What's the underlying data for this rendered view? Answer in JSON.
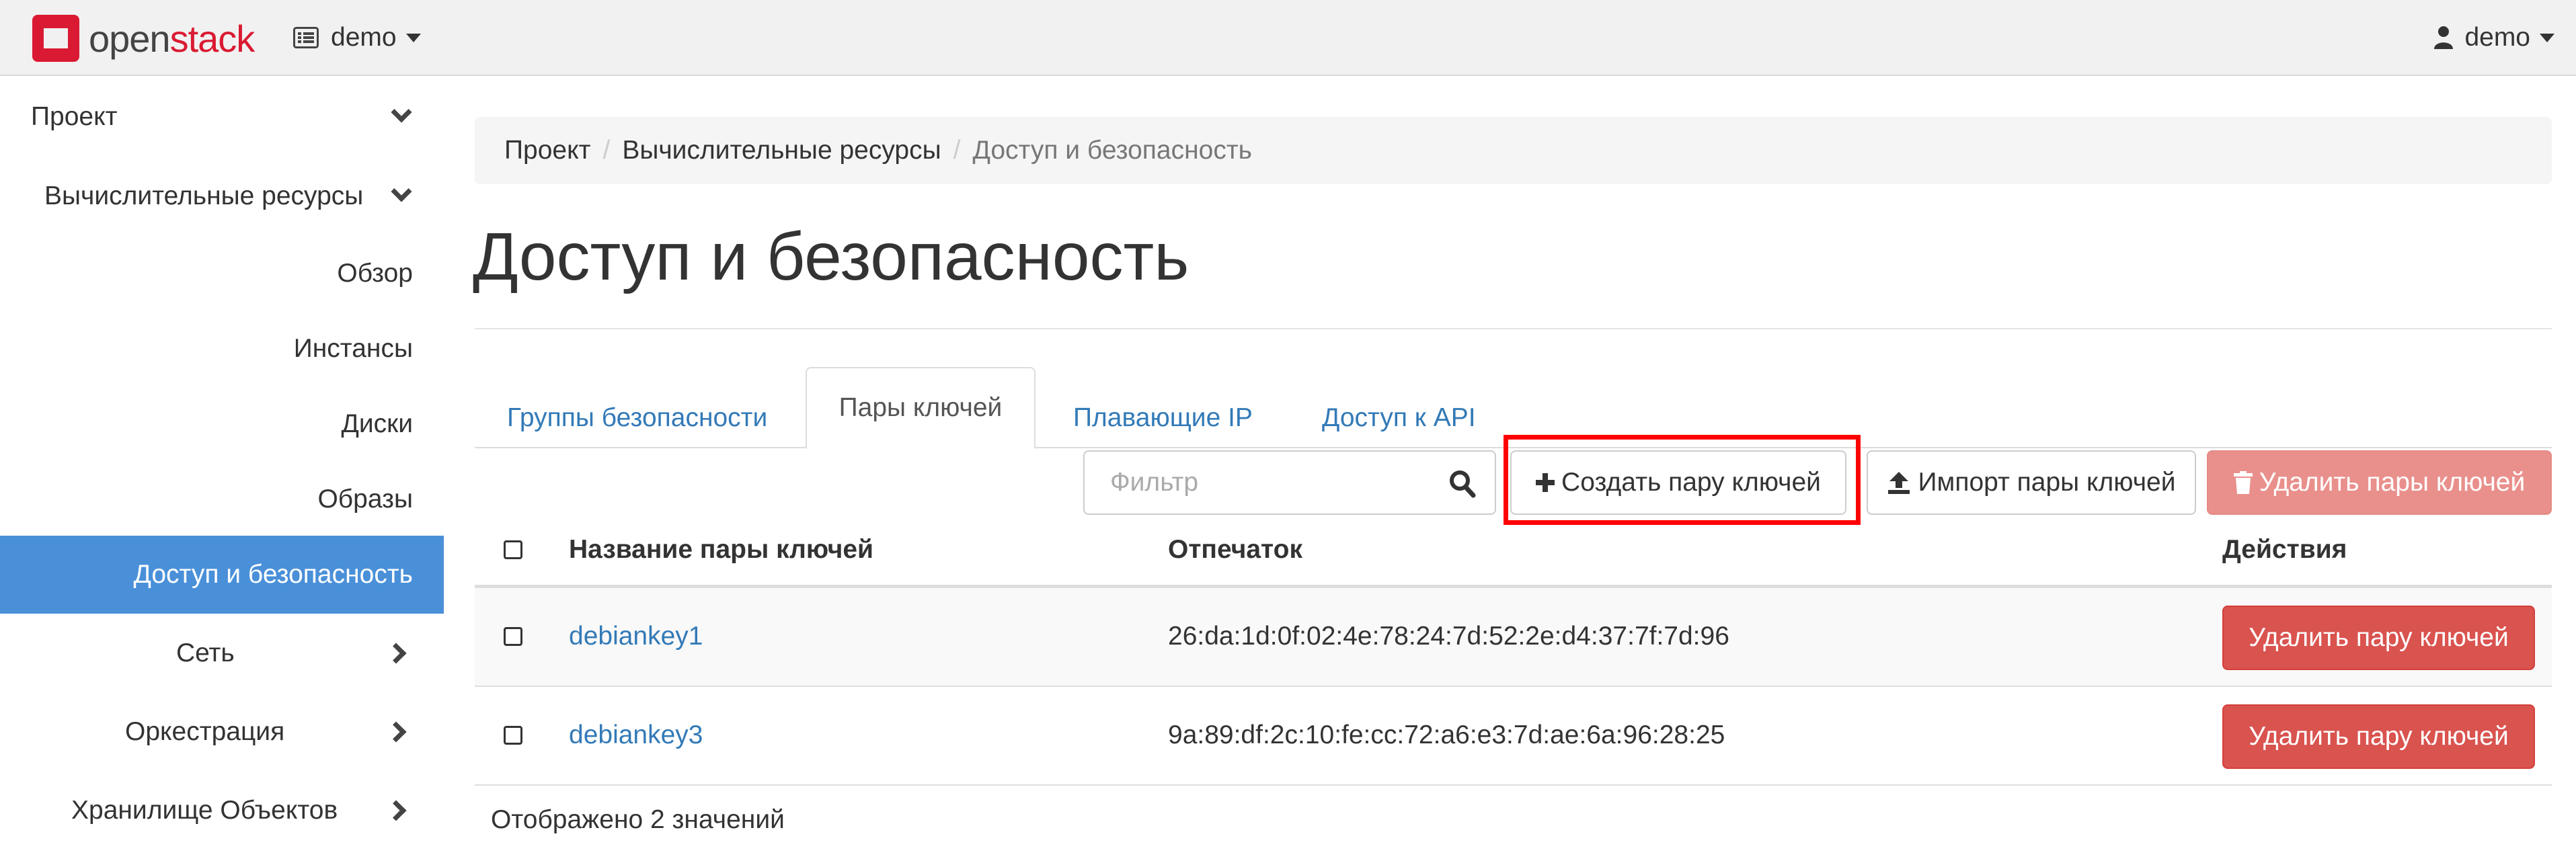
{
  "brand": {
    "open": "open",
    "stack": "stack"
  },
  "topbar": {
    "project_label": "demo",
    "user_label": "demo"
  },
  "sidebar": {
    "project": "Проект",
    "compute": "Вычислительные ресурсы",
    "items": [
      "Обзор",
      "Инстансы",
      "Диски",
      "Образы",
      "Доступ и безопасность"
    ],
    "network": "Сеть",
    "orchestration": "Оркестрация",
    "object_store": "Хранилище Объектов"
  },
  "breadcrumb": [
    "Проект",
    "Вычислительные ресурсы",
    "Доступ и безопасность"
  ],
  "page_title": "Доступ и безопасность",
  "tabs": [
    "Группы безопасности",
    "Пары ключей",
    "Плавающие IP",
    "Доступ к API"
  ],
  "toolbar": {
    "filter_placeholder": "Фильтр",
    "create_label": "Создать пару ключей",
    "import_label": "Импорт пары ключей",
    "delete_label": "Удалить пары ключей"
  },
  "table": {
    "headers": [
      "Название пары ключей",
      "Отпечаток",
      "Действия"
    ],
    "rows": [
      {
        "name": "debiankey1",
        "fingerprint": "26:da:1d:0f:02:4e:78:24:7d:52:2e:d4:37:7f:7d:96",
        "action": "Удалить пару ключей"
      },
      {
        "name": "debiankey3",
        "fingerprint": "9a:89:df:2c:10:fe:cc:72:a6:e3:7d:ae:6a:96:28:25",
        "action": "Удалить пару ключей"
      }
    ],
    "footer": "Отображено 2 значений"
  },
  "colors": {
    "accent": "#4a90d9",
    "link": "#337ab7",
    "danger": "#d9534f",
    "brand_red": "#da1a32",
    "highlight": "#ff0000"
  }
}
